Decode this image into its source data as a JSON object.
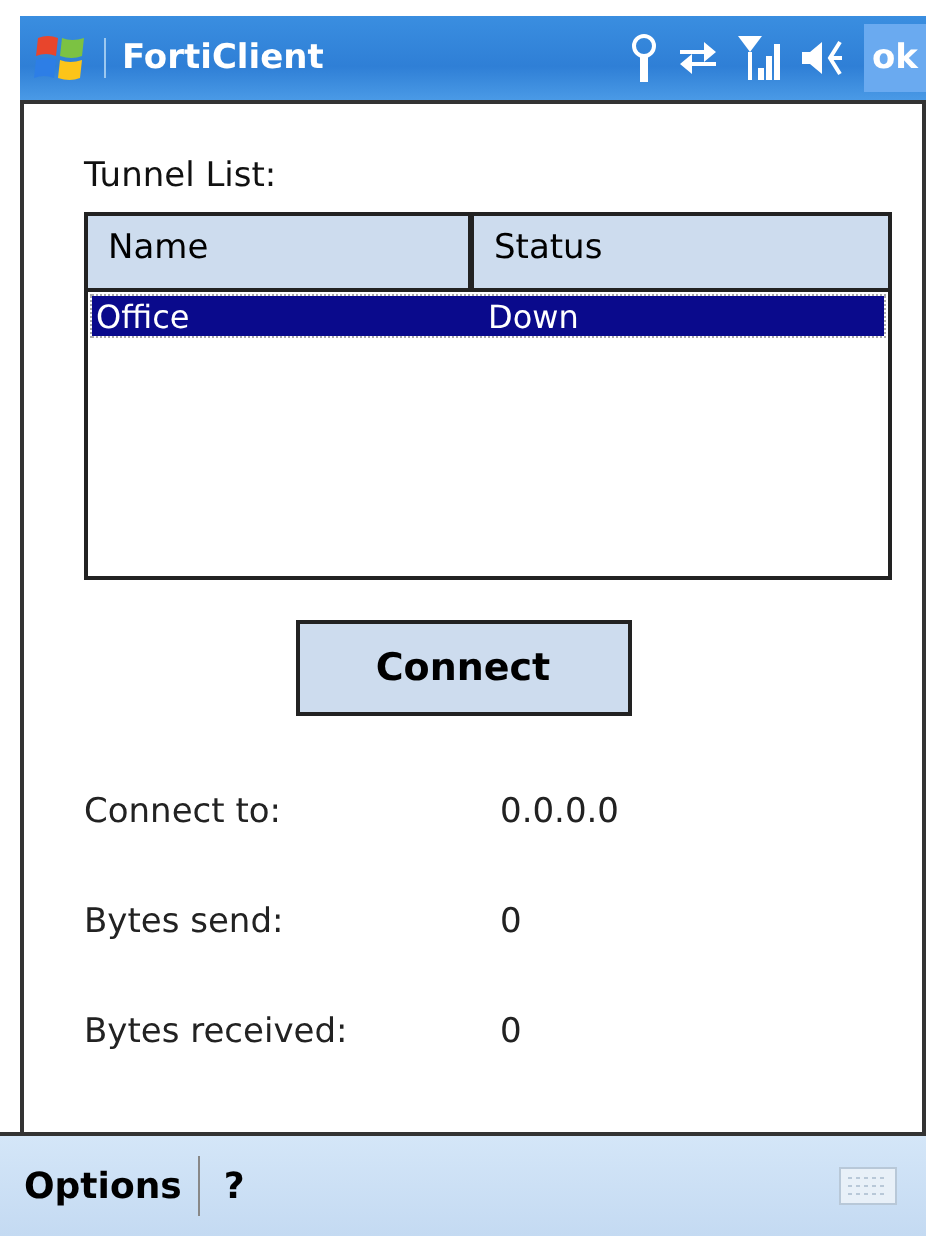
{
  "title_bar": {
    "title": "FortiClient",
    "ok": "ok"
  },
  "tunnel_list": {
    "label": "Tunnel List:",
    "columns": [
      "Name",
      "Status"
    ],
    "rows": [
      {
        "cells": [
          "Office",
          "Down"
        ],
        "selected": true
      }
    ]
  },
  "connect_button": "Connect",
  "info": [
    {
      "label": "Connect to:",
      "value": "0.0.0.0"
    },
    {
      "label": "Bytes send:",
      "value": "0"
    },
    {
      "label": "Bytes received:",
      "value": "0"
    }
  ],
  "menu_bar": {
    "left": "Options",
    "right": "?"
  }
}
